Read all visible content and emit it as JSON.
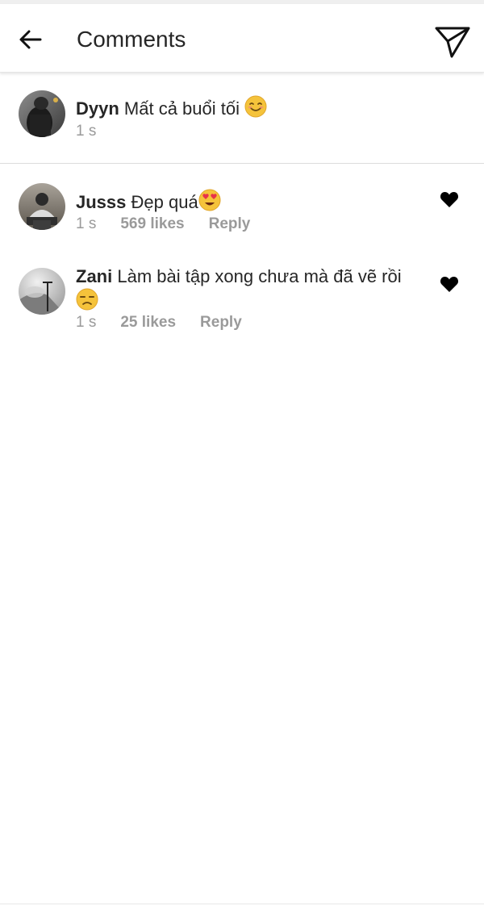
{
  "header": {
    "title": "Comments",
    "back_icon": "arrow-left-icon",
    "send_icon": "paper-plane-icon"
  },
  "caption": {
    "username": "Dyyn",
    "text": "Mất cả buổi tối",
    "emoji": "smiling-face-icon",
    "time": "1 s"
  },
  "comments": [
    {
      "username": "Jusss",
      "text": "Đẹp quá",
      "emoji": "heart-eyes-icon",
      "time": "1 s",
      "likes": "569 likes",
      "reply": "Reply",
      "liked": true
    },
    {
      "username": "Zani",
      "text": "Làm bài tập xong chưa mà đã vẽ rồi",
      "emoji": "unamused-face-icon",
      "time": "1 s",
      "likes": "25 likes",
      "reply": "Reply",
      "liked": true
    }
  ],
  "colors": {
    "text": "#262626",
    "meta": "#9a9a9a",
    "divider": "#dcdcdc",
    "heart": "#000000",
    "emoji": "#f5c33b"
  }
}
